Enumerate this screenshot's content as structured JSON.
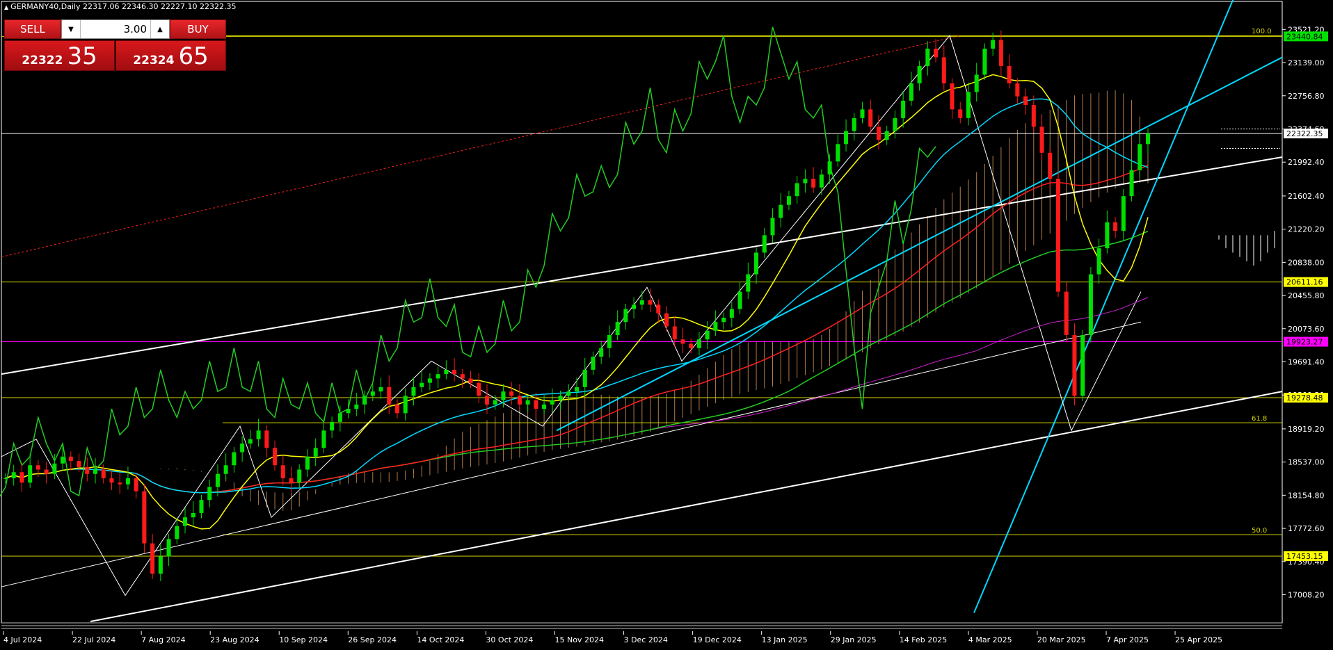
{
  "header": {
    "symbol_line": "GERMANY40,Daily  22317.06 22346.30 22227.10 22322.35"
  },
  "trade_panel": {
    "sell_label": "SELL",
    "buy_label": "BUY",
    "volume": "3.00",
    "bid_prefix": "22322",
    "bid_big": "35",
    "ask_prefix": "22324",
    "ask_big": "65",
    "down_arrow_icon": "triangle-down",
    "up_arrow_icon": "triangle-up"
  },
  "colors": {
    "background": "#000000",
    "bull_candle": "#00e000",
    "bear_candle": "#ff1a1a",
    "tenkan": "#ffff00",
    "kijun": "#00d8ff",
    "chikou": "#22cc22",
    "ma_fast": "#ff2020",
    "ma_mid": "#20cc20",
    "ma_slow": "#cc22cc",
    "cloud": "#d2925a",
    "level_line": "#d8d800",
    "magenta_level": "#ff00ff"
  },
  "chart_data": {
    "type": "candlestick",
    "symbol": "GERMANY40",
    "timeframe": "Daily",
    "last_ohlc": {
      "open": 22317.06,
      "high": 22346.3,
      "low": 22227.1,
      "close": 22322.35
    },
    "ylim": [
      16700,
      23700
    ],
    "y_ticks": [
      "23521.20",
      "23139.00",
      "22756.80",
      "22374.60",
      "21992.40",
      "21602.40",
      "21220.20",
      "20838.00",
      "20455.80",
      "20073.60",
      "19691.40",
      "19309.20",
      "18919.20",
      "18537.00",
      "18154.80",
      "17772.60",
      "17390.40",
      "17008.20"
    ],
    "x_labels": [
      "4 Jul 2024",
      "22 Jul 2024",
      "7 Aug 2024",
      "23 Aug 2024",
      "10 Sep 2024",
      "26 Sep 2024",
      "14 Oct 2024",
      "30 Oct 2024",
      "15 Nov 2024",
      "3 Dec 2024",
      "19 Dec 2024",
      "13 Jan 2025",
      "29 Jan 2025",
      "14 Feb 2025",
      "4 Mar 2025",
      "20 Mar 2025",
      "7 Apr 2025",
      "25 Apr 2025"
    ],
    "horizontal_levels": [
      {
        "price": 23440.84,
        "label": "23440.84",
        "box_color": "#00e000",
        "text_color": "#000000"
      },
      {
        "price": 22322.35,
        "label": "22322.35",
        "box_color": "#ffffff",
        "text_color": "#000000"
      },
      {
        "price": 20611.16,
        "label": "20611.16",
        "box_color": "#ffff00",
        "text_color": "#000000"
      },
      {
        "price": 19923.27,
        "label": "19923.27",
        "box_color": "#ff00ff",
        "text_color": "#000000"
      },
      {
        "price": 19278.48,
        "label": "19278.48",
        "box_color": "#ffff00",
        "text_color": "#000000"
      },
      {
        "price": 17453.15,
        "label": "17453.15",
        "box_color": "#ffff00",
        "text_color": "#000000"
      }
    ],
    "fib_levels": [
      {
        "price": 23450.0,
        "label": "100.0"
      },
      {
        "price": 18990.0,
        "label": "61.8"
      },
      {
        "price": 17700.0,
        "label": "50.0"
      }
    ],
    "closes": [
      18350,
      18420,
      18300,
      18500,
      18450,
      18400,
      18520,
      18600,
      18550,
      18480,
      18400,
      18450,
      18350,
      18300,
      18280,
      18350,
      18200,
      17600,
      17250,
      17450,
      17650,
      17800,
      17900,
      17950,
      18100,
      18250,
      18400,
      18500,
      18650,
      18750,
      18800,
      18900,
      18700,
      18500,
      18350,
      18300,
      18450,
      18600,
      18700,
      18900,
      19000,
      19100,
      19150,
      19200,
      19300,
      19350,
      19400,
      19200,
      19100,
      19300,
      19400,
      19450,
      19500,
      19550,
      19600,
      19550,
      19500,
      19450,
      19300,
      19200,
      19250,
      19350,
      19300,
      19200,
      19250,
      19150,
      19200,
      19250,
      19300,
      19350,
      19400,
      19600,
      19750,
      19850,
      20000,
      20150,
      20300,
      20350,
      20400,
      20350,
      20250,
      20100,
      19950,
      19900,
      19850,
      19950,
      20050,
      20150,
      20200,
      20300,
      20500,
      20700,
      20950,
      21150,
      21350,
      21500,
      21600,
      21750,
      21800,
      21700,
      21850,
      22000,
      22200,
      22350,
      22500,
      22600,
      22400,
      22250,
      22350,
      22500,
      22700,
      22900,
      23100,
      23300,
      23200,
      22900,
      22600,
      22500,
      22800,
      23000,
      23300,
      23400,
      23100,
      22900,
      22750,
      22650,
      22400,
      22100,
      21800,
      20500,
      20000,
      19300,
      20000,
      20700,
      21000,
      21300,
      21200,
      21600,
      21900,
      22200,
      22322.35
    ],
    "ichimoku_future": [
      21150,
      21150,
      21150,
      21150,
      21150,
      21150,
      21150,
      21150,
      21200
    ],
    "cloud_top_future": [
      21100,
      21000,
      20950,
      20900,
      20850,
      20800,
      20850,
      20950,
      21000
    ]
  }
}
